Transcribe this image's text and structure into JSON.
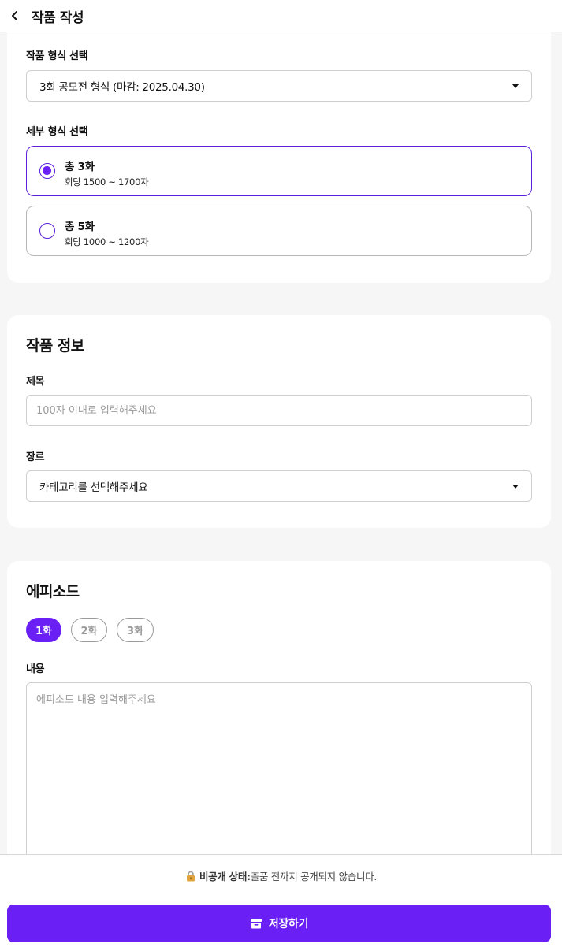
{
  "header": {
    "title": "작품 작성"
  },
  "format": {
    "label": "작품 형식 선택",
    "selected": "3회 공모전 형식 (마감: 2025.04.30)",
    "sub_label": "세부 형식 선택",
    "options": [
      {
        "title": "총 3화",
        "sub": "회당 1500 ~ 1700자",
        "selected": true
      },
      {
        "title": "총 5화",
        "sub": "회당 1000 ~ 1200자",
        "selected": false
      }
    ]
  },
  "info": {
    "title": "작품 정보",
    "title_label": "제목",
    "title_placeholder": "100자 이내로 입력해주세요",
    "genre_label": "장르",
    "genre_selected": "카테고리를 선택해주세요"
  },
  "episode": {
    "title": "에피소드",
    "tabs": [
      "1화",
      "2화",
      "3화"
    ],
    "active_tab": 0,
    "content_label": "내용",
    "content_placeholder": "에피소드 내용 입력해주세요"
  },
  "footer": {
    "status_label": "비공개 상태:",
    "status_text": "출품 전까지 공개되지 않습니다.",
    "save_label": "저장하기"
  },
  "colors": {
    "accent": "#6a1ff5"
  }
}
